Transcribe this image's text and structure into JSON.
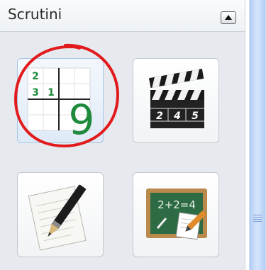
{
  "panel": {
    "title": "Scrutini"
  },
  "tiles": {
    "sudoku": {
      "cells": [
        "2",
        "3",
        "1"
      ],
      "big_digit": "9"
    },
    "clapperboard": {
      "digits": [
        "2",
        "4",
        "5"
      ]
    },
    "notepad": {},
    "chalkboard": {
      "text": "2+2=4"
    }
  },
  "colors": {
    "annotation_circle": "#e11b1b",
    "sudoku_digit": "#1e8a3c",
    "chalkboard": "#2d6b45"
  }
}
